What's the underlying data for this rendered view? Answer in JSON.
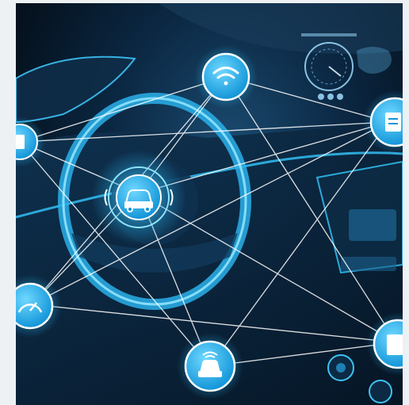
{
  "scene": {
    "description_icons": [
      "car-icon",
      "wifi-icon",
      "gauge-icon",
      "document-icon",
      "card-icon"
    ],
    "accent_color": "#33c8ff",
    "node_color": "#1fb5ef",
    "line_color": "#ffffff",
    "background_dark": "#05121f"
  }
}
